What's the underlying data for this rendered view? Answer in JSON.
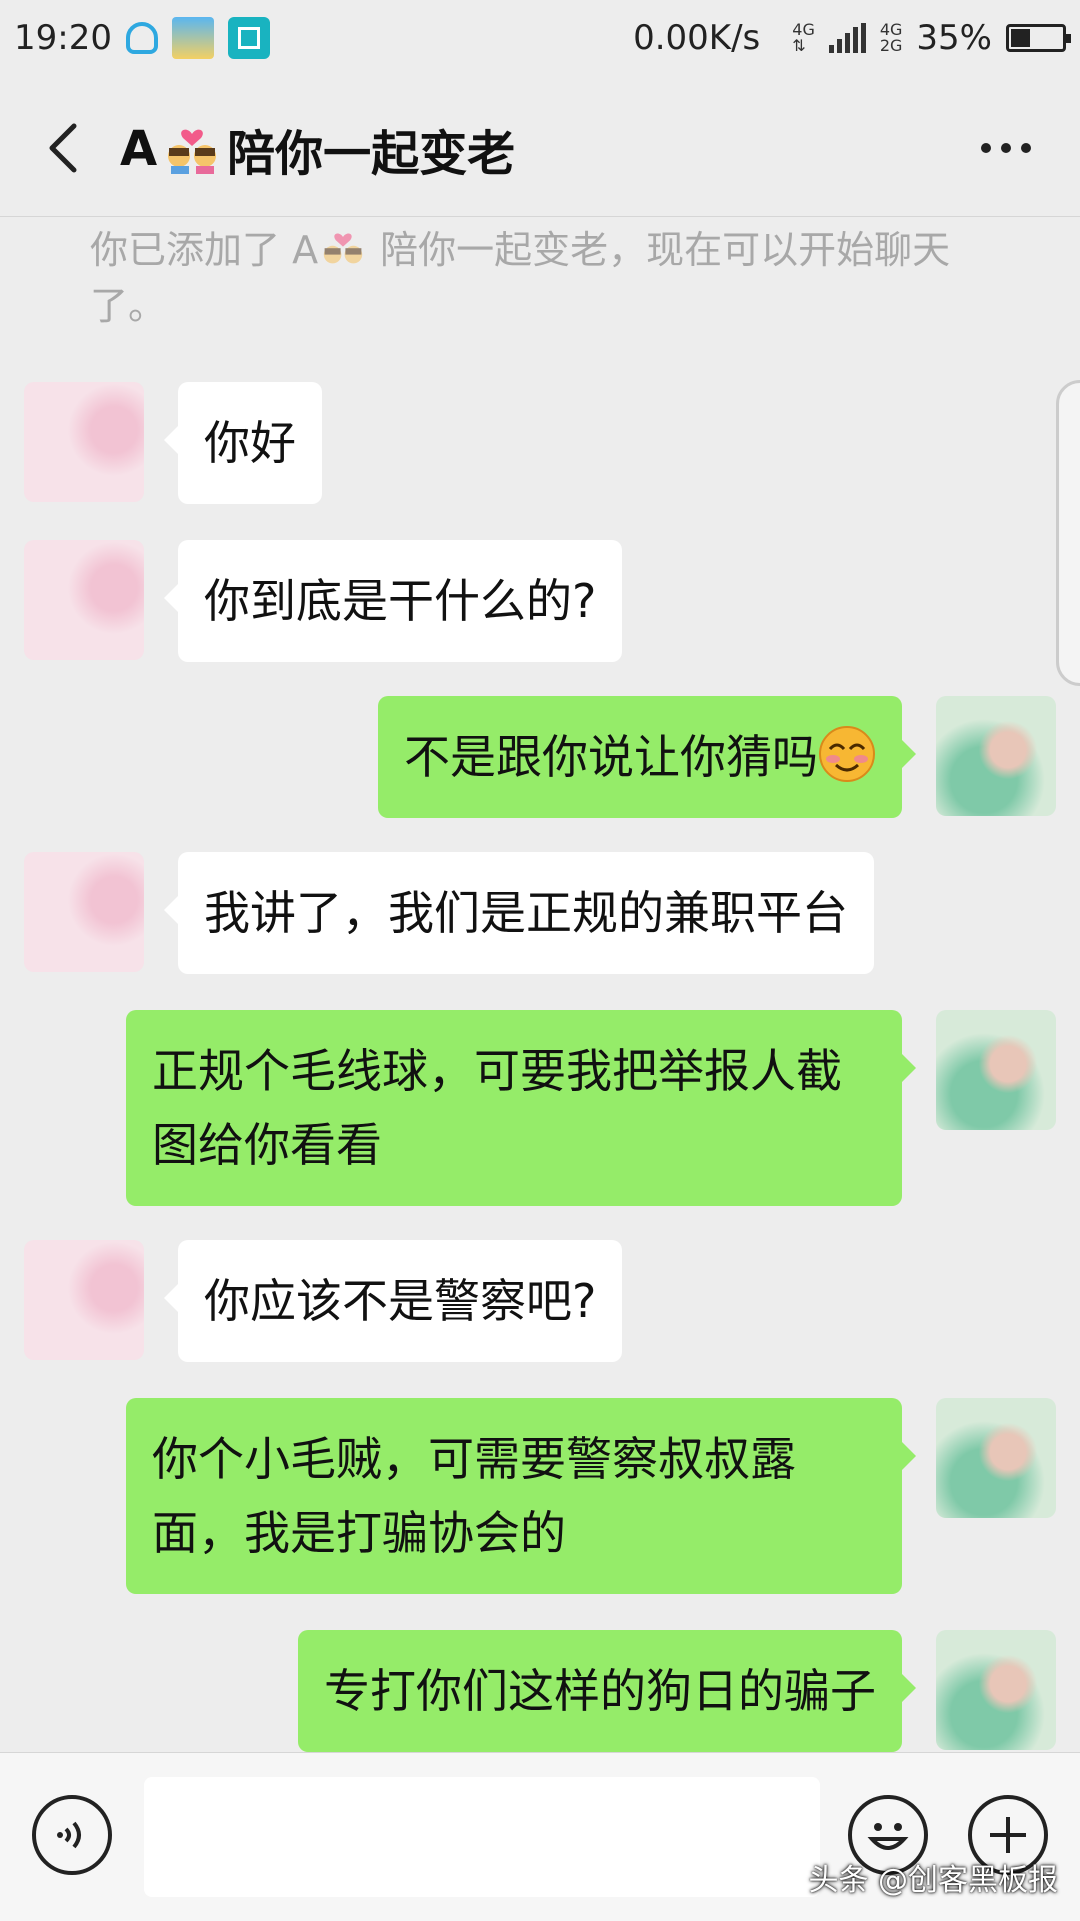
{
  "status_bar": {
    "time": "19:20",
    "net_speed": "0.00K/s",
    "sig1_top": "4G",
    "sig1_bottom": "⇅",
    "sig2_top": "4G",
    "sig2_bottom": "2G",
    "battery_percent": "35%",
    "battery_level": 0.35
  },
  "header": {
    "title_prefix": "A",
    "title_emoji": "couple-kiss-emoji",
    "title_name": "陪你一起变老",
    "back_icon": "chevron-left-icon",
    "more_icon": "more-dots-icon"
  },
  "system_notice": {
    "part1": "你已添加了 A",
    "part2": " 陪你一起变老，现在可以开始聊天了。"
  },
  "messages": [
    {
      "side": "in",
      "text": "你好"
    },
    {
      "side": "in",
      "text": "你到底是干什么的?"
    },
    {
      "side": "out",
      "text": "不是跟你说让你猜吗",
      "emoji": "blush-smile-emoji"
    },
    {
      "side": "in",
      "text": "我讲了，我们是正规的兼职平台"
    },
    {
      "side": "out",
      "text": "正规个毛线球，可要我把举报人截图给你看看"
    },
    {
      "side": "in",
      "text": "你应该不是警察吧?"
    },
    {
      "side": "out",
      "text": "你个小毛贼，可需要警察叔叔露面，我是打骗协会的"
    },
    {
      "side": "out",
      "text": "专打你们这样的狗日的骗子"
    }
  ],
  "input_bar": {
    "voice_icon": "voice-icon",
    "emoji_icon": "smiley-icon",
    "plus_icon": "plus-icon",
    "message_value": ""
  },
  "watermark": "头条 @创客黑板报",
  "colors": {
    "background": "#ededed",
    "outgoing_bubble": "#95ec69",
    "incoming_bubble": "#ffffff",
    "notice_text": "#a8a8a8"
  }
}
